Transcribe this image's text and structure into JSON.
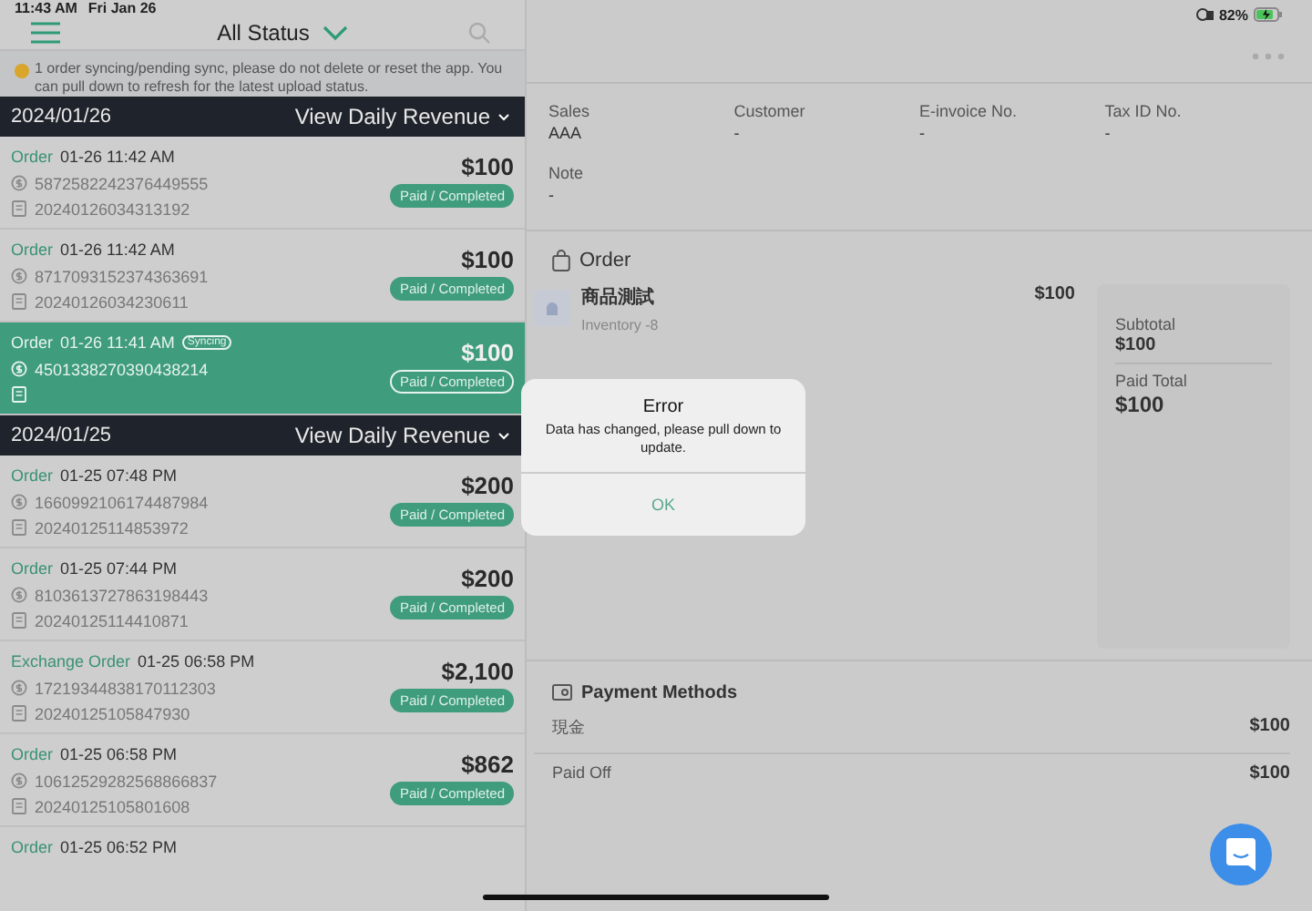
{
  "status_bar": {
    "time": "11:43 AM",
    "date": "Fri Jan 26",
    "battery": "82%"
  },
  "list_header": {
    "filter": "All Status"
  },
  "sync_banner": {
    "text": "1 order syncing/pending sync, please do not delete or reset the app. You can pull down to refresh for the latest upload status."
  },
  "groups": [
    {
      "date": "2024/01/26",
      "link": "View Daily Revenue",
      "orders": [
        {
          "type": "Order",
          "time": "01-26 11:42 AM",
          "syncing": false,
          "number": "5872582242376449555",
          "invoice": "20240126034313192",
          "amount": "$100",
          "status": "Paid / Completed",
          "selected": false
        },
        {
          "type": "Order",
          "time": "01-26 11:42 AM",
          "syncing": false,
          "number": "8717093152374363691",
          "invoice": "20240126034230611",
          "amount": "$100",
          "status": "Paid / Completed",
          "selected": false
        },
        {
          "type": "Order",
          "time": "01-26 11:41 AM",
          "syncing": true,
          "sync_label": "Syncing",
          "number": "4501338270390438214",
          "amount": "$100",
          "status": "Paid / Completed",
          "selected": true
        }
      ]
    },
    {
      "date": "2024/01/25",
      "link": "View Daily Revenue",
      "orders": [
        {
          "type": "Order",
          "time": "01-25 07:48 PM",
          "syncing": false,
          "number": "1660992106174487984",
          "invoice": "20240125114853972",
          "amount": "$200",
          "status": "Paid / Completed",
          "selected": false
        },
        {
          "type": "Order",
          "time": "01-25 07:44 PM",
          "syncing": false,
          "number": "8103613727863198443",
          "invoice": "20240125114410871",
          "amount": "$200",
          "status": "Paid / Completed",
          "selected": false
        },
        {
          "type": "Exchange Order",
          "time": "01-25 06:58 PM",
          "syncing": false,
          "number": "17219344838170112303",
          "invoice": "20240125105847930",
          "amount": "$2,100",
          "status": "Paid / Completed",
          "selected": false
        },
        {
          "type": "Order",
          "time": "01-25 06:58 PM",
          "syncing": false,
          "number": "10612529282568866837",
          "invoice": "20240125105801608",
          "amount": "$862",
          "status": "Paid / Completed",
          "selected": false
        },
        {
          "type": "Order",
          "time": "01-25 06:52 PM",
          "syncing": false,
          "selected": false
        }
      ]
    }
  ],
  "details": {
    "fields": [
      {
        "label": "Sales",
        "value": "AAA"
      },
      {
        "label": "Customer",
        "value": "-"
      },
      {
        "label": "E-invoice No.",
        "value": "-"
      },
      {
        "label": "Tax ID No.",
        "value": "-"
      },
      {
        "label": "Note",
        "value": "-"
      }
    ]
  },
  "order": {
    "title": "Order",
    "items": [
      {
        "name": "商品測試",
        "inventory": "Inventory -8",
        "price": "$100"
      }
    ],
    "totals": [
      {
        "label": "Subtotal",
        "value": "$100"
      },
      {
        "label": "Paid Total",
        "value": "$100"
      }
    ]
  },
  "payment": {
    "title": "Payment Methods",
    "rows": [
      {
        "label": "現金",
        "value": "$100"
      },
      {
        "label": "Paid Off",
        "value": "$100"
      }
    ]
  },
  "dialog": {
    "title": "Error",
    "message": "Data has changed, please pull down to update.",
    "button": "OK"
  }
}
